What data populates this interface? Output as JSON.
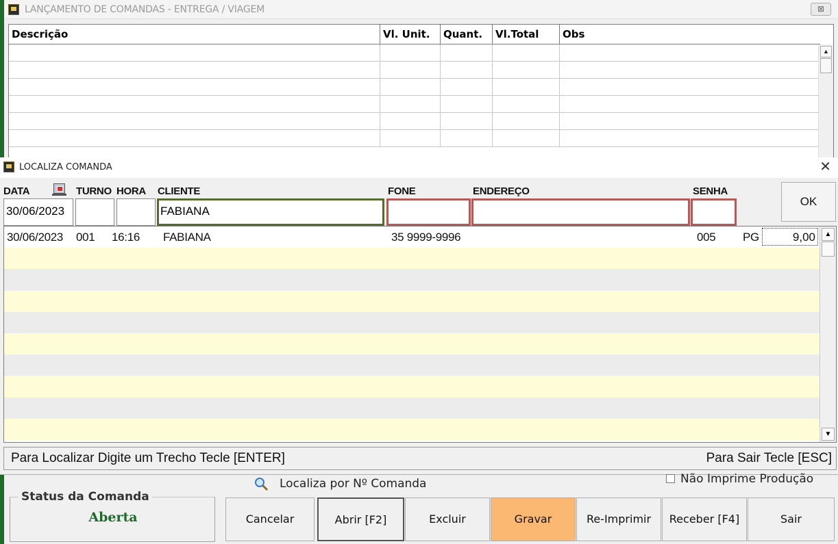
{
  "back_window": {
    "title": "LANÇAMENTO DE COMANDAS - ENTREGA / VIAGEM",
    "close_label": "⊠",
    "grid": {
      "columns": [
        "Descrição",
        "Vl. Unit.",
        "Quant.",
        "Vl.Total",
        "Obs"
      ]
    }
  },
  "dialog": {
    "title": "LOCALIZA COMANDA",
    "close_label": "✕",
    "labels": {
      "data": "DATA",
      "turno": "TURNO",
      "hora": "HORA",
      "cliente": "CLIENTE",
      "fone": "FONE",
      "endereco": "ENDEREÇO",
      "senha": "SENHA"
    },
    "fields": {
      "data": "30/06/2023",
      "turno": "",
      "hora": "",
      "cliente": "FABIANA",
      "fone": "",
      "endereco": "",
      "senha": ""
    },
    "ok_label": "OK",
    "results": [
      {
        "data": "30/06/2023",
        "turno": "001",
        "hora": "16:16",
        "cliente": "FABIANA",
        "fone": "35 9999-9996",
        "senha": "005",
        "status": "PG",
        "valor": "9,00"
      }
    ],
    "status_left": "Para Localizar Digite um Trecho Tecle [ENTER]",
    "status_right": "Para Sair Tecle [ESC]"
  },
  "bottom": {
    "localiza_label": "Localiza por Nº Comanda",
    "nao_imprime_label": "Não Imprime Produção",
    "status_legend": "Status da Comanda",
    "status_value": "Aberta",
    "buttons": {
      "cancelar": "Cancelar",
      "abrir": "Abrir [F2]",
      "excluir": "Excluir",
      "gravar": "Gravar",
      "reimprimir": "Re-Imprimir",
      "receber": "Receber [F4]",
      "sair": "Sair"
    }
  },
  "colors": {
    "accent_green": "#1e6b2c",
    "cliente_border": "#556b2f",
    "filter_border_red": "#b55a5a",
    "gravar_bg": "#fbb872",
    "row_yellow": "#fffdd8",
    "row_gray": "#ececec"
  }
}
